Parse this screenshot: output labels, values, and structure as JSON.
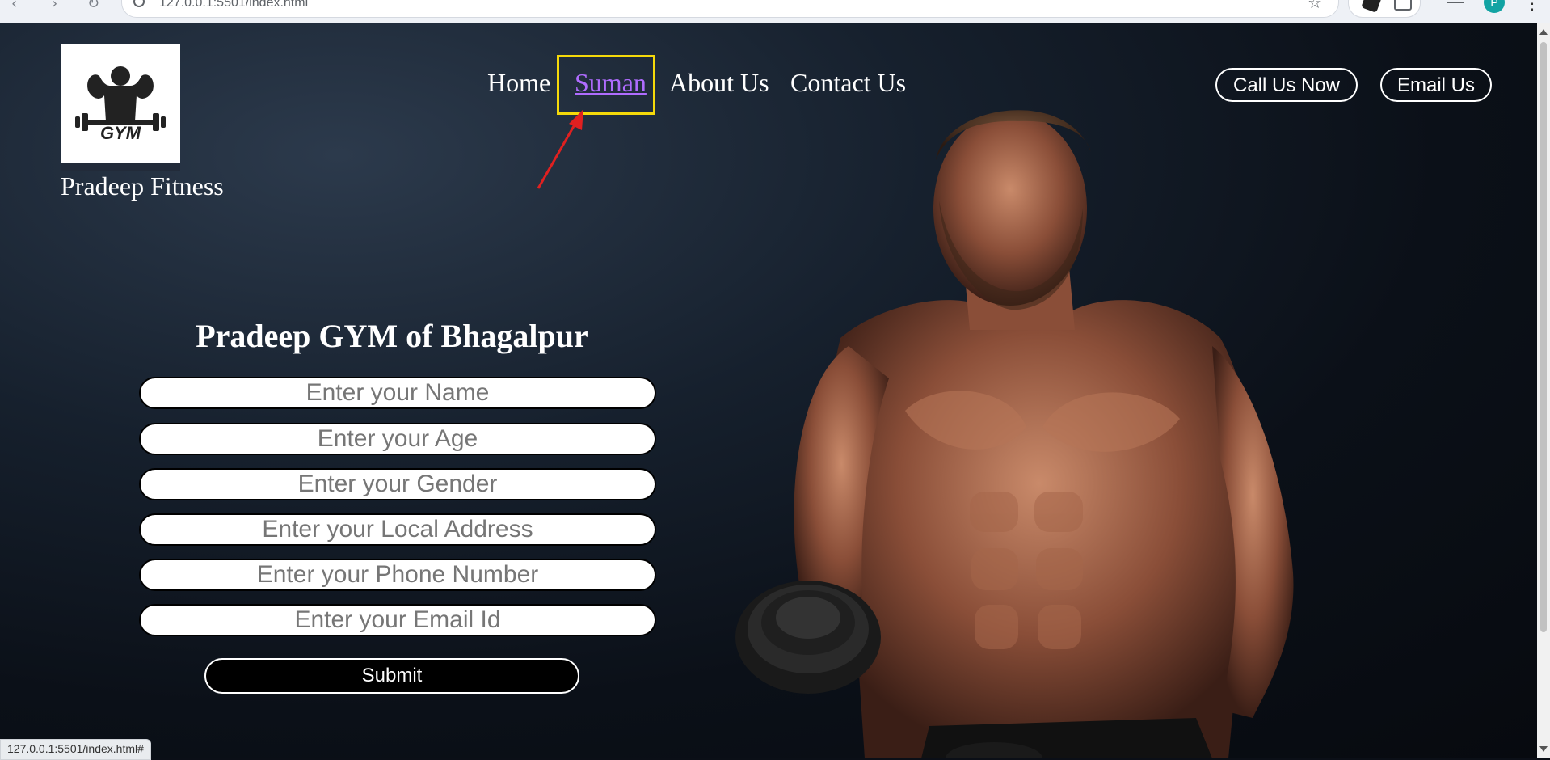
{
  "browser": {
    "url": "127.0.0.1:5501/index.html",
    "status_url": "127.0.0.1:5501/index.html#",
    "profile_initial": "P"
  },
  "brand": {
    "logo_text": "GYM",
    "name": "Pradeep Fitness"
  },
  "nav": {
    "links": [
      {
        "label": "Home"
      },
      {
        "label": "Suman"
      },
      {
        "label": "About Us"
      },
      {
        "label": "Contact Us"
      }
    ],
    "call_button": "Call Us Now",
    "email_button": "Email Us"
  },
  "form": {
    "title": "Pradeep GYM of Bhagalpur",
    "fields": [
      {
        "placeholder": "Enter your Name"
      },
      {
        "placeholder": "Enter your Age"
      },
      {
        "placeholder": "Enter your Gender"
      },
      {
        "placeholder": "Enter your Local Address"
      },
      {
        "placeholder": "Enter your Phone Number"
      },
      {
        "placeholder": "Enter your Email Id"
      }
    ],
    "submit_label": "Submit"
  },
  "colors": {
    "highlight": "#f5d90a",
    "annotation_arrow": "#e02020",
    "visited_link": "#b06cff"
  }
}
